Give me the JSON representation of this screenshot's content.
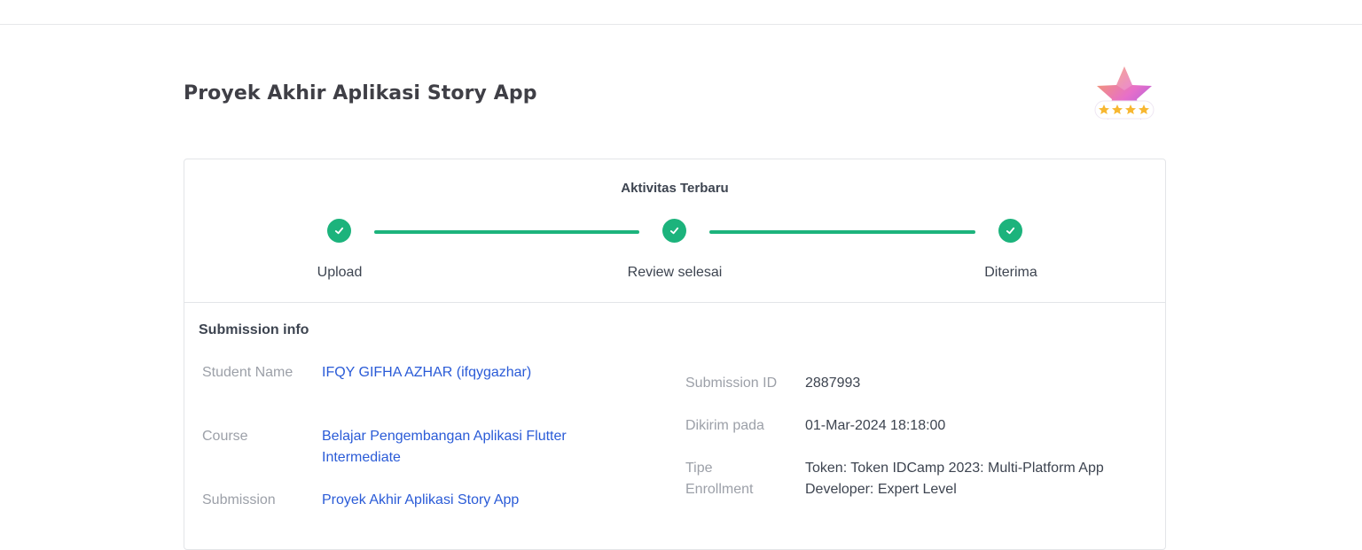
{
  "page": {
    "title": "Proyek Akhir Aplikasi Story App"
  },
  "badge": {
    "icon": "star-rating-badge-icon",
    "stars": 4
  },
  "activity": {
    "title": "Aktivitas Terbaru",
    "steps": [
      {
        "label": "Upload",
        "done": true
      },
      {
        "label": "Review selesai",
        "done": true
      },
      {
        "label": "Diterima",
        "done": true
      }
    ],
    "accent_color": "#1cb37c"
  },
  "submission_info": {
    "title": "Submission info",
    "student_name": {
      "label": "Student Name",
      "value": "IFQY GIFHA AZHAR (ifqygazhar)"
    },
    "course": {
      "label": "Course",
      "value": "Belajar Pengembangan Aplikasi Flutter Intermediate"
    },
    "submission": {
      "label": "Submission",
      "value": "Proyek Akhir Aplikasi Story App"
    },
    "submission_id": {
      "label": "Submission ID",
      "value": "2887993"
    },
    "sent_at": {
      "label": "Dikirim pada",
      "value": "01-Mar-2024 18:18:00"
    },
    "enrollment_type": {
      "label": "Tipe Enrollment",
      "value": "Token: Token IDCamp 2023: Multi-Platform App Developer: Expert Level"
    }
  },
  "colors": {
    "link": "#2a5bd7",
    "label": "#9ca0a8",
    "text": "#3d4450"
  }
}
